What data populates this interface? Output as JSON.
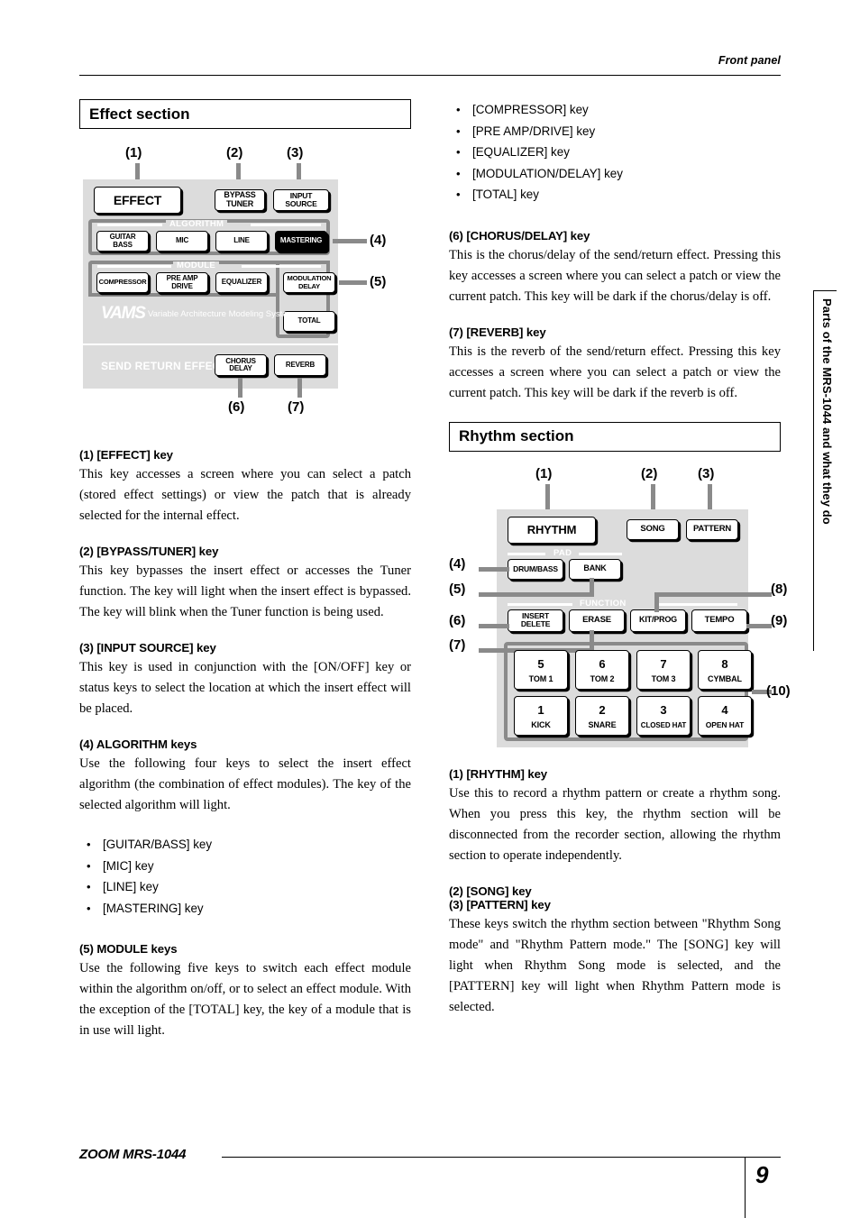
{
  "header": {
    "title": "Front panel"
  },
  "side_tab": {
    "label": "Parts of the MRS-1044 and what they do"
  },
  "footer": {
    "brand": "ZOOM MRS-1044",
    "page": "9"
  },
  "effect": {
    "section_title": "Effect section",
    "diagram": {
      "callouts": [
        "(1)",
        "(2)",
        "(3)",
        "(4)",
        "(5)",
        "(6)",
        "(7)"
      ],
      "buttons": {
        "effect": "EFFECT",
        "bypass_tuner": "BYPASS\nTUNER",
        "bypass_line1": "BYPASS",
        "bypass_line2": "TUNER",
        "input_source": "INPUT SOURCE"
      },
      "algorithm_group_label": "ALGORITHM",
      "algorithm_keys": [
        {
          "line1": "GUITAR",
          "line2": "BASS",
          "selected": false
        },
        {
          "line1": "MIC",
          "line2": "",
          "selected": false
        },
        {
          "line1": "LINE",
          "line2": "",
          "selected": false
        },
        {
          "line1": "MASTERING",
          "line2": "",
          "selected": true
        }
      ],
      "module_group_label": "MODULE",
      "module_keys": [
        {
          "line1": "COMPRESSOR",
          "line2": ""
        },
        {
          "line1": "PRE AMP",
          "line2": "DRIVE"
        },
        {
          "line1": "EQUALIZER",
          "line2": ""
        },
        {
          "line1": "MODULATION",
          "line2": "DELAY"
        },
        {
          "line1": "TOTAL",
          "line2": ""
        }
      ],
      "vams_logo": "VAMS",
      "vams_subtitle": "Variable Architecture Modeling System",
      "send_return_label": "SEND RETURN EFFECT",
      "send_return_keys": [
        {
          "line1": "CHORUS",
          "line2": "DELAY"
        },
        {
          "line1": "REVERB",
          "line2": ""
        }
      ]
    },
    "items": [
      {
        "head": "(1) [EFFECT] key",
        "body": "This key accesses a screen where you can select a patch (stored effect settings) or view the patch that is already selected for the internal effect."
      },
      {
        "head": "(2) [BYPASS/TUNER] key",
        "body": "This key bypasses the insert effect or accesses the Tuner function. The key will light when the insert effect is bypassed. The key will blink when the Tuner function is being used."
      },
      {
        "head": "(3) [INPUT SOURCE] key",
        "body": "This key is used in conjunction with the [ON/OFF] key or status keys to select the location at which the insert effect will be placed."
      },
      {
        "head": "(4) ALGORITHM keys",
        "body": "Use the following four keys to select the insert effect algorithm (the combination of effect modules). The key of the selected algorithm will light."
      },
      {
        "head": "(5) MODULE keys",
        "body": "Use the following five keys to switch each effect module within the algorithm on/off, or to select an effect module. With the exception of the [TOTAL] key, the key of a module that is in use will light."
      },
      {
        "head": "(6) [CHORUS/DELAY] key",
        "body": "This is the chorus/delay of the send/return effect. Pressing this key accesses a screen where you can select a patch or view the current patch. This key will be dark if the chorus/delay is off."
      },
      {
        "head": "(7) [REVERB] key",
        "body": "This is the reverb of the send/return effect. Pressing this key accesses a screen where you can select a patch or view the current patch. This key will be dark if the reverb is off."
      }
    ],
    "algorithm_bullets": [
      "[GUITAR/BASS] key",
      "[MIC] key",
      "[LINE] key",
      "[MASTERING] key"
    ],
    "module_bullets": [
      "[COMPRESSOR] key",
      "[PRE AMP/DRIVE] key",
      "[EQUALIZER] key",
      "[MODULATION/DELAY] key",
      "[TOTAL] key"
    ]
  },
  "rhythm": {
    "section_title": "Rhythm section",
    "diagram": {
      "callouts": [
        "(1)",
        "(2)",
        "(3)",
        "(4)",
        "(5)",
        "(6)",
        "(7)",
        "(8)",
        "(9)",
        "(10)"
      ],
      "buttons": {
        "rhythm": "RHYTHM",
        "song": "SONG",
        "pattern": "PATTERN"
      },
      "pad_group_label": "PAD",
      "pad_keys": [
        {
          "line1": "DRUM/BASS",
          "line2": ""
        },
        {
          "line1": "BANK",
          "line2": ""
        }
      ],
      "function_group_label": "FUNCTION",
      "function_keys": [
        {
          "line1": "INSERT",
          "line2": "DELETE"
        },
        {
          "line1": "ERASE",
          "line2": ""
        },
        {
          "line1": "KIT/PROG",
          "line2": ""
        },
        {
          "line1": "TEMPO",
          "line2": ""
        }
      ],
      "pads": [
        {
          "num": "5",
          "name": "TOM 1"
        },
        {
          "num": "6",
          "name": "TOM 2"
        },
        {
          "num": "7",
          "name": "TOM 3"
        },
        {
          "num": "8",
          "name": "CYMBAL"
        },
        {
          "num": "1",
          "name": "KICK"
        },
        {
          "num": "2",
          "name": "SNARE"
        },
        {
          "num": "3",
          "name": "CLOSED HAT"
        },
        {
          "num": "4",
          "name": "OPEN HAT"
        }
      ]
    },
    "items": [
      {
        "head": "(1) [RHYTHM] key",
        "body": "Use this to record a rhythm pattern or create a rhythm song. When you press this key, the rhythm section will be disconnected from the recorder section, allowing the rhythm section to operate independently."
      },
      {
        "head1": "(2) [SONG] key",
        "head2": "(3) [PATTERN] key",
        "body": "These keys switch the rhythm section between \"Rhythm Song mode\" and \"Rhythm Pattern mode.\" The [SONG] key will light when Rhythm Song mode is selected, and the [PATTERN] key will light when Rhythm Pattern mode is selected."
      }
    ]
  }
}
